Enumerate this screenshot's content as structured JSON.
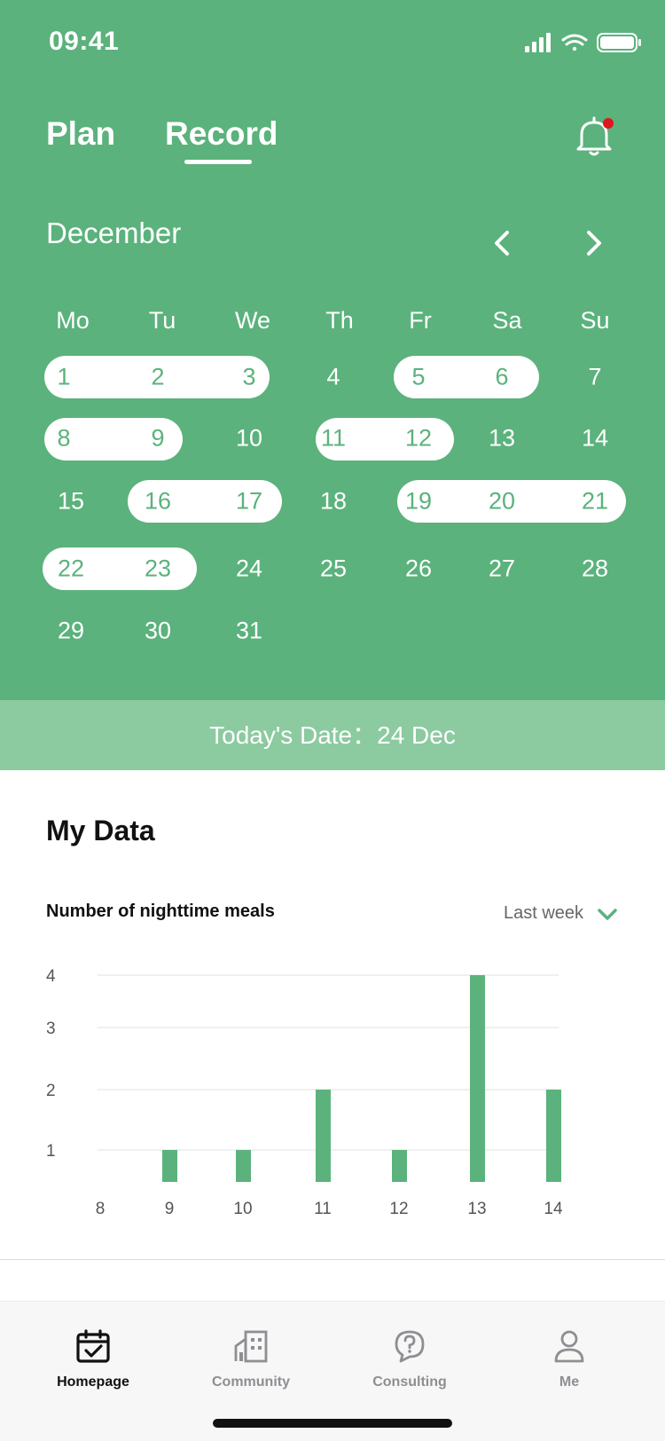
{
  "status_bar": {
    "time": "09:41"
  },
  "tabs": [
    {
      "label": "Plan",
      "active": false
    },
    {
      "label": "Record",
      "active": true
    }
  ],
  "colors": {
    "brand": "#5bb27c",
    "brand_light": "#8ccaa0",
    "badge": "#e0161e"
  },
  "icons": {
    "notification": "bell-icon",
    "prev": "chevron-left-icon",
    "next": "chevron-right-icon",
    "dropdown": "chevron-down-icon"
  },
  "calendar": {
    "month": "December",
    "weekdays": [
      "Mo",
      "Tu",
      "We",
      "Th",
      "Fr",
      "Sa",
      "Su"
    ],
    "days": [
      "1",
      "2",
      "3",
      "4",
      "5",
      "6",
      "7",
      "8",
      "9",
      "10",
      "11",
      "12",
      "13",
      "14",
      "15",
      "16",
      "17",
      "18",
      "19",
      "20",
      "21",
      "22",
      "23",
      "24",
      "25",
      "26",
      "27",
      "28",
      "29",
      "30",
      "31"
    ],
    "marked_days": [
      1,
      2,
      3,
      5,
      6,
      8,
      9,
      11,
      12,
      16,
      17,
      19,
      20,
      21,
      22,
      23
    ]
  },
  "today": {
    "text": "Today's Date：24 Dec"
  },
  "my_data": {
    "title": "My Data",
    "chart_title": "Number of nighttime meals",
    "period": "Last week"
  },
  "chart_data": {
    "type": "bar",
    "categories": [
      "8",
      "9",
      "10",
      "11",
      "12",
      "13",
      "14"
    ],
    "values": [
      0,
      1,
      1,
      2,
      1,
      4,
      2
    ],
    "yticks": [
      "1",
      "2",
      "3",
      "4"
    ],
    "ylim": [
      0,
      4
    ],
    "grid": true
  },
  "tabbar": {
    "items": [
      {
        "label": "Homepage",
        "icon": "calendar-check-icon",
        "active": true
      },
      {
        "label": "Community",
        "icon": "buildings-icon",
        "active": false
      },
      {
        "label": "Consulting",
        "icon": "question-chat-icon",
        "active": false
      },
      {
        "label": "Me",
        "icon": "person-icon",
        "active": false
      }
    ]
  }
}
